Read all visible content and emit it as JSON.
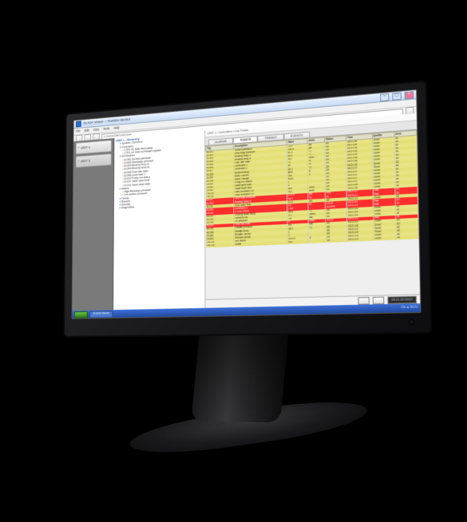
{
  "window": {
    "title": "SCADA Viewer — Runtime Monitor",
    "menu": [
      "File",
      "Edit",
      "View",
      "Tools",
      "Help"
    ],
    "address": "C:\\Units\\Site\\Unit1\\Live"
  },
  "sidebar": {
    "units": [
      {
        "chevron": "»",
        "label": "UNIT 1"
      },
      {
        "chevron": "»",
        "label": "UNIT 2"
      }
    ]
  },
  "tree": {
    "header": "UNIT 1  ·  Hierarchy",
    "rootLabel": "Plant",
    "nodes": [
      "System / Overview",
      "Controllers",
      "  CTRL-01  Main feed pump",
      "  CTRL-02  Heat exchanger bypass",
      "I/O Modules",
      "  AI-001  Suction pressure",
      "  AI-002  Discharge pressure",
      "  AI-003  Bearing temp A",
      "  AI-004  Bearing temp B",
      "  AI-005  Flow rate main",
      "  AI-006  Level tank 1",
      "  DI-010  Pump run status",
      "  DI-011  Valve open limit",
      "  DI-012  Valve close limit",
      "Alarms",
      "  High discharge pressure",
      "  Low suction pressure",
      "Trends",
      "Reports",
      "Security",
      "Diagnostics"
    ]
  },
  "main": {
    "breadcrumb": "UNIT 1  ›  Controllers  ›  Live Points",
    "tabs": [
      "ALARMS",
      "POINTS",
      "TRENDS",
      "EVENTS"
    ],
    "activeTab": 1,
    "columns": [
      "Tag",
      "Description",
      "Value",
      "Units",
      "Status",
      "Time",
      "Quality",
      "Area"
    ],
    "rows": [
      {
        "alarm": false,
        "c": [
          "AI-001",
          "Suction pressure",
          "73.2",
          "psi",
          "OK",
          "09:21:04",
          "Good",
          "A1"
        ]
      },
      {
        "alarm": false,
        "c": [
          "AI-002",
          "Discharge pressure",
          "148.6",
          "psi",
          "OK",
          "09:21:04",
          "Good",
          "A1"
        ]
      },
      {
        "alarm": false,
        "c": [
          "AI-003",
          "Bearing temp A",
          "61.4",
          "°C",
          "OK",
          "09:21:05",
          "Good",
          "A1"
        ]
      },
      {
        "alarm": false,
        "c": [
          "AI-004",
          "Bearing temp B",
          "63.0",
          "°C",
          "OK",
          "09:21:05",
          "Good",
          "A1"
        ]
      },
      {
        "alarm": false,
        "c": [
          "AI-005",
          "Flow rate main",
          "412",
          "m3/h",
          "OK",
          "09:21:05",
          "Good",
          "A1"
        ]
      },
      {
        "alarm": false,
        "c": [
          "AI-006",
          "Level tank 1",
          "71",
          "%",
          "OK",
          "09:21:06",
          "Good",
          "A2"
        ]
      },
      {
        "alarm": false,
        "c": [
          "AI-007",
          "Level tank 2",
          "54",
          "%",
          "OK",
          "09:21:06",
          "Good",
          "A2"
        ]
      },
      {
        "alarm": false,
        "c": [
          "AI-008",
          "Ambient temp",
          "24.1",
          "°C",
          "OK",
          "09:21:06",
          "Good",
          "A2"
        ]
      },
      {
        "alarm": false,
        "c": [
          "AI-009",
          "Motor current",
          "88.5",
          "A",
          "OK",
          "09:21:07",
          "Good",
          "A1"
        ]
      },
      {
        "alarm": false,
        "c": [
          "AI-010",
          "Motor voltage",
          "415",
          "V",
          "OK",
          "09:21:07",
          "Good",
          "A1"
        ]
      },
      {
        "alarm": false,
        "c": [
          "DI-010",
          "Pump run status",
          "RUN",
          "",
          "OK",
          "09:21:07",
          "Good",
          "A1"
        ]
      },
      {
        "alarm": false,
        "c": [
          "DI-011",
          "Valve open limit",
          "1",
          "",
          "OK",
          "09:21:07",
          "Good",
          "A1"
        ]
      },
      {
        "alarm": false,
        "c": [
          "DI-012",
          "Valve close limit",
          "0",
          "",
          "OK",
          "09:21:07",
          "Good",
          "A1"
        ]
      },
      {
        "alarm": false,
        "c": [
          "PID-01",
          "Flow controller SP",
          "400",
          "m3/h",
          "OK",
          "09:21:08",
          "Good",
          "A1"
        ]
      },
      {
        "alarm": false,
        "c": [
          "PID-01",
          "Flow controller PV",
          "412",
          "m3/h",
          "OK",
          "09:21:08",
          "Good",
          "A1"
        ]
      },
      {
        "alarm": true,
        "c": [
          "AI-002",
          "Discharge pressure",
          "171.9",
          "psi",
          "HIHI",
          "09:21:12",
          "Bad",
          "A1"
        ]
      },
      {
        "alarm": true,
        "c": [
          "AI-003",
          "Bearing temp A",
          "94.7",
          "°C",
          "HI",
          "09:21:12",
          "Bad",
          "A1"
        ]
      },
      {
        "alarm": false,
        "c": [
          "AI-011",
          "Seal water flow",
          "12.3",
          "l/m",
          "OK",
          "09:21:13",
          "Good",
          "A1"
        ]
      },
      {
        "alarm": true,
        "c": [
          "AI-006",
          "Level tank 1",
          "12",
          "%",
          "LOLO",
          "09:21:15",
          "Bad",
          "A2"
        ]
      },
      {
        "alarm": true,
        "c": [
          "DI-020",
          "E-Stop circuit",
          "TRIP",
          "",
          "ALARM",
          "09:21:15",
          "Bad",
          "A1"
        ]
      },
      {
        "alarm": false,
        "c": [
          "AI-012",
          "Cooling water temp",
          "28.6",
          "°C",
          "OK",
          "09:21:16",
          "Good",
          "A2"
        ]
      },
      {
        "alarm": false,
        "c": [
          "AI-013",
          "Gearbox vib",
          "2.1",
          "mm/s",
          "OK",
          "09:21:16",
          "Good",
          "A1"
        ]
      },
      {
        "alarm": false,
        "c": [
          "AI-014",
          "Oil pressure",
          "3.4",
          "bar",
          "OK",
          "09:21:16",
          "Good",
          "A1"
        ]
      },
      {
        "alarm": true,
        "c": [
          "AI-005",
          "Flow rate main",
          "0",
          "m3/h",
          "LOLO",
          "09:21:18",
          "Bad",
          "A1"
        ]
      },
      {
        "alarm": false,
        "c": [
          "AI-015",
          "Header pressure",
          "5.6",
          "bar",
          "OK",
          "09:21:18",
          "Good",
          "A2"
        ]
      },
      {
        "alarm": false,
        "c": [
          "AI-016",
          "Header temp",
          "44.0",
          "°C",
          "OK",
          "09:21:18",
          "Good",
          "A2"
        ]
      },
      {
        "alarm": false,
        "c": [
          "DI-030",
          "Breaker closed",
          "1",
          "",
          "OK",
          "09:21:19",
          "Good",
          "A1"
        ]
      },
      {
        "alarm": false,
        "c": [
          "DI-031",
          "Remote permit",
          "1",
          "",
          "OK",
          "09:21:19",
          "Good",
          "A1"
        ]
      },
      {
        "alarm": false,
        "c": [
          "CNT-01",
          "Run hours",
          "14120",
          "h",
          "OK",
          "09:21:19",
          "Good",
          "A1"
        ]
      },
      {
        "alarm": false,
        "c": [
          "CNT-02",
          "Starts",
          "612",
          "",
          "OK",
          "09:21:19",
          "Good",
          "A1"
        ]
      }
    ]
  },
  "status": {
    "clock": "09:21:19  04/12"
  },
  "taskbar": {
    "app": "SCADA Viewer",
    "tray": "EN  ▲  09:21"
  }
}
